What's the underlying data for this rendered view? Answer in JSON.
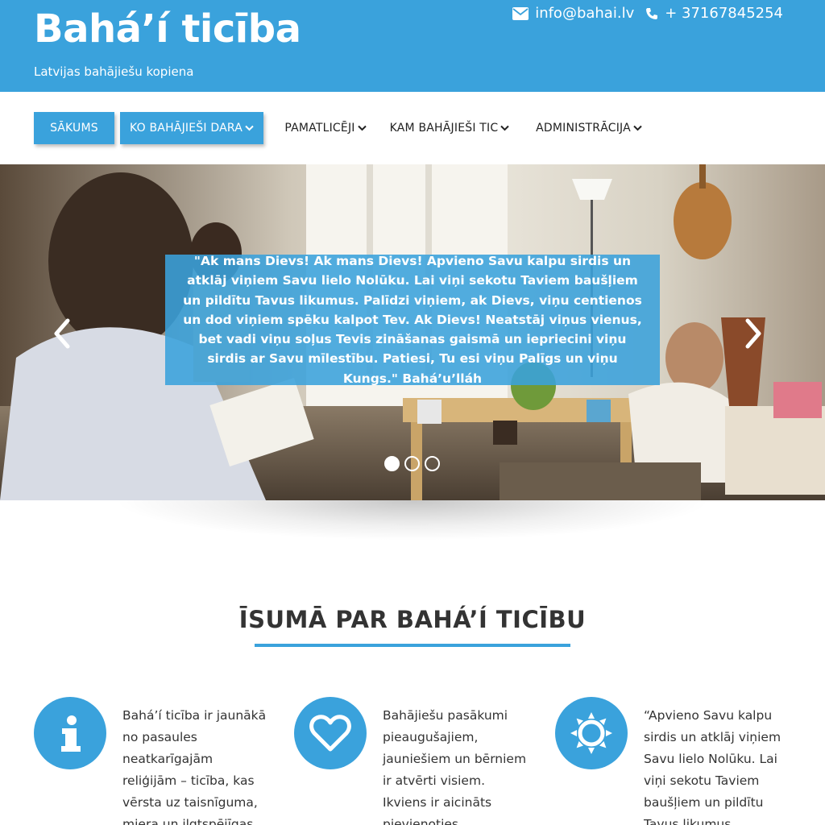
{
  "header": {
    "title": "Bahá’í ticība",
    "subtitle": "Latvijas bahājiešu kopiena",
    "email": "info@bahai.lv",
    "phone": "+ 37167845254",
    "email_icon": "envelope-icon",
    "phone_icon": "phone-icon"
  },
  "nav": {
    "items": [
      {
        "label": "SĀKUMS",
        "dropdown": false,
        "active": true
      },
      {
        "label": "KO BAHĀJIEŠI DARA",
        "dropdown": true,
        "active": true
      },
      {
        "label": "PAMATLICĒJI",
        "dropdown": true,
        "active": false
      },
      {
        "label": "KAM BAHĀJIEŠI TIC",
        "dropdown": true,
        "active": false
      },
      {
        "label": "ADMINISTRĀCIJA",
        "dropdown": true,
        "active": false
      }
    ]
  },
  "hero": {
    "quote": "\"Ak mans Dievs! Ak mans Dievs! Apvieno Savu kalpu sirdis un atklāj viņiem Savu lielo Nolūku. Lai viņi sekotu Taviem baušļiem un pildītu Tavus likumus. Palīdzi viņiem, ak Dievs, viņu centienos un dod viņiem spēku kalpot Tev. Ak Dievs! Neatstāj viņus vienus, bet vadi viņu soļus Tevis zināšanas gaismā un iepriecini viņu sirdis ar Savu mīlestību. Patiesi, Tu esi viņu Palīgs un viņu Kungs.\" Bahá’u’lláh",
    "slide_count": 3,
    "active_slide": 1
  },
  "section": {
    "title": "ĪSUMĀ PAR BAHÁ’Í TICĪBU",
    "features": [
      {
        "icon": "info-icon",
        "text": "Bahá’í ticība ir jaunākā no pasaules neatkarīgajām reliģijām – ticība, kas vērsta uz taisnīguma, miera un ilgtspējīgas pasaules"
      },
      {
        "icon": "heart-icon",
        "text": "Bahājiešu pasākumi pieaugušajiem, jauniešiem un bērniem ir atvērti visiem. Ikviens ir aicināts pievienoties kalpošanas un kopīgas"
      },
      {
        "icon": "sun-icon",
        "text": "“Apvieno Savu kalpu sirdis un atklāj viņiem Savu lielo Nolūku. Lai viņi sekotu Taviem baušļiem un pildītu Tavus likumus. Apvieno"
      }
    ]
  },
  "colors": {
    "brand": "#3aa2dc"
  }
}
